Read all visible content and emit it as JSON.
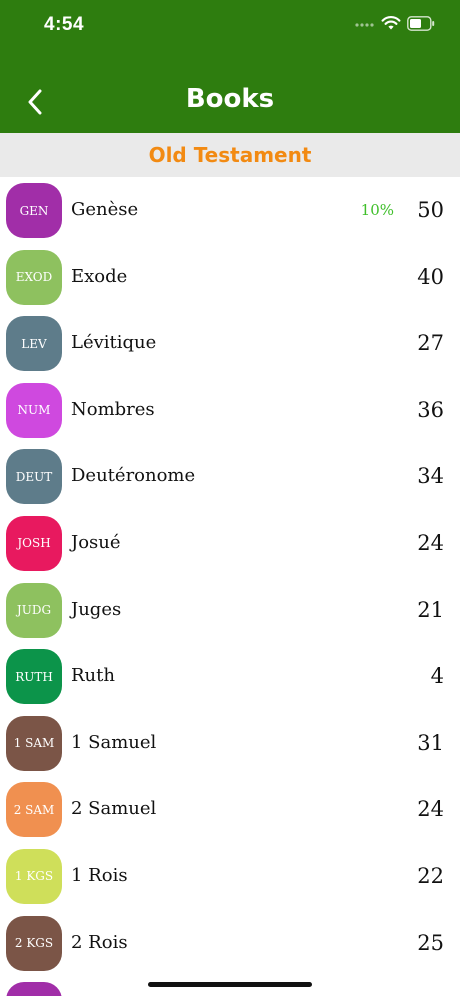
{
  "status_bar": {
    "time": "4:54"
  },
  "header": {
    "title": "Books"
  },
  "section": {
    "title": "Old Testament"
  },
  "books": [
    {
      "abbr": "GEN",
      "name": "Genèse",
      "progress": "10%",
      "chapters": "50",
      "color": "#a12ea8"
    },
    {
      "abbr": "EXOD",
      "name": "Exode",
      "progress": "",
      "chapters": "40",
      "color": "#8ec15f"
    },
    {
      "abbr": "LEV",
      "name": "Lévitique",
      "progress": "",
      "chapters": "27",
      "color": "#5e7c8a"
    },
    {
      "abbr": "NUM",
      "name": "Nombres",
      "progress": "",
      "chapters": "36",
      "color": "#cf49df"
    },
    {
      "abbr": "DEUT",
      "name": "Deutéronome",
      "progress": "",
      "chapters": "34",
      "color": "#5e7c8a"
    },
    {
      "abbr": "JOSH",
      "name": "Josué",
      "progress": "",
      "chapters": "24",
      "color": "#e8195f"
    },
    {
      "abbr": "JUDG",
      "name": "Juges",
      "progress": "",
      "chapters": "21",
      "color": "#8ec15f"
    },
    {
      "abbr": "RUTH",
      "name": "Ruth",
      "progress": "",
      "chapters": "4",
      "color": "#0c944a"
    },
    {
      "abbr": "1 SAM",
      "name": "1 Samuel",
      "progress": "",
      "chapters": "31",
      "color": "#7b5547"
    },
    {
      "abbr": "2 SAM",
      "name": "2 Samuel",
      "progress": "",
      "chapters": "24",
      "color": "#f09050"
    },
    {
      "abbr": "1 KGS",
      "name": "1 Rois",
      "progress": "",
      "chapters": "22",
      "color": "#cfdf5a"
    },
    {
      "abbr": "2 KGS",
      "name": "2 Rois",
      "progress": "",
      "chapters": "25",
      "color": "#7b5547"
    },
    {
      "abbr": "",
      "name": "",
      "progress": "",
      "chapters": "",
      "color": "#a12ea8"
    }
  ]
}
